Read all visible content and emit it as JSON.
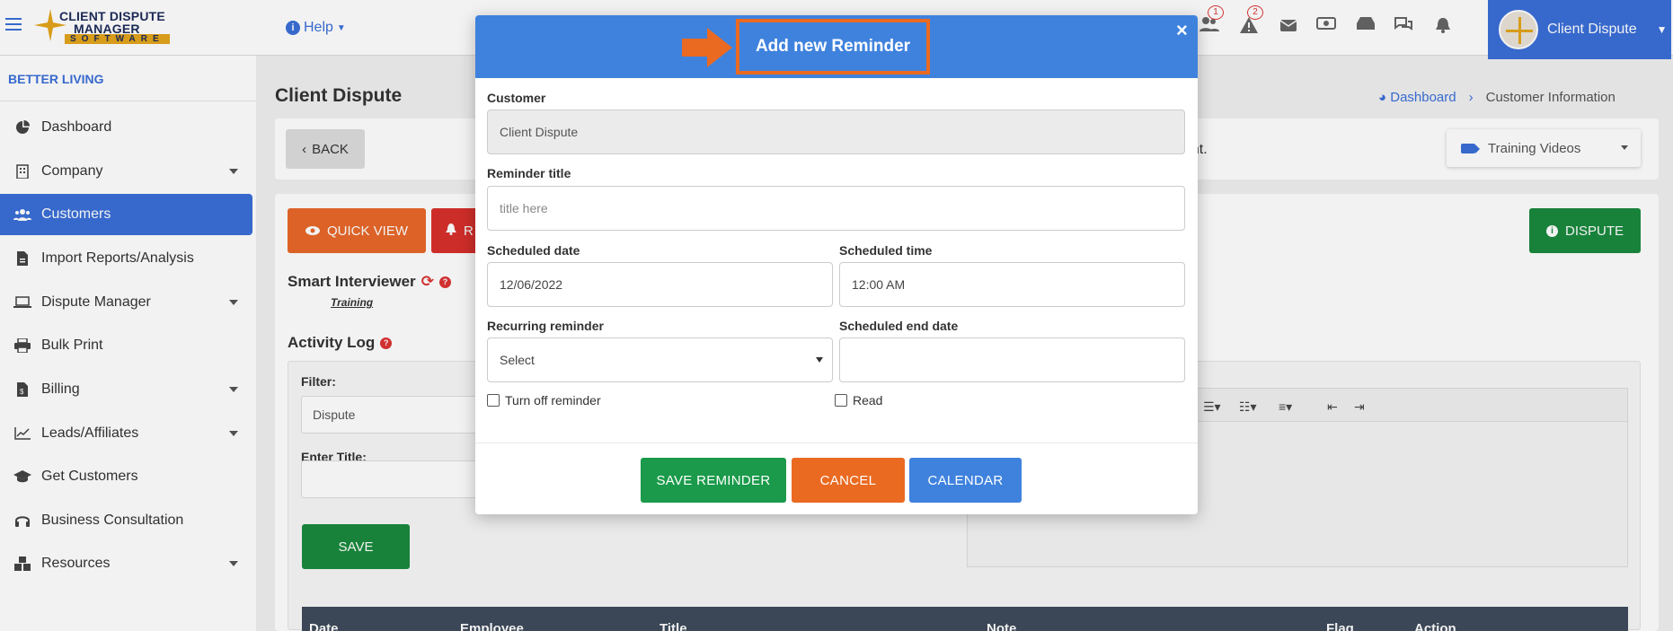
{
  "topbar": {
    "help_label": "Help",
    "logo": {
      "line1": "CLIENT DISPUTE",
      "line2": "MANAGER",
      "line3": "SOFTWARE"
    },
    "icon_badges": [
      "1",
      "2"
    ],
    "user_name": "Client Dispute"
  },
  "sidebar": {
    "org_name": "BETTER LIVING",
    "items": [
      {
        "label": "Dashboard",
        "icon": "dashboard-icon"
      },
      {
        "label": "Company",
        "icon": "building-icon"
      },
      {
        "label": "Customers",
        "icon": "users-icon"
      },
      {
        "label": "Import Reports/Analysis",
        "icon": "file-import-icon"
      },
      {
        "label": "Dispute Manager",
        "icon": "laptop-icon"
      },
      {
        "label": "Bulk Print",
        "icon": "printer-icon"
      },
      {
        "label": "Billing",
        "icon": "invoice-icon"
      },
      {
        "label": "Leads/Affiliates",
        "icon": "chart-icon"
      },
      {
        "label": "Get Customers",
        "icon": "graduation-cap-icon"
      },
      {
        "label": "Business Consultation",
        "icon": "headset-icon"
      },
      {
        "label": "Resources",
        "icon": "boxes-icon"
      }
    ]
  },
  "main": {
    "title": "Client Dispute",
    "breadcrumb": {
      "home": "Dashboard",
      "current": "Customer Information"
    },
    "back_label": "BACK",
    "notice_fragment": "unt.",
    "training_videos_label": "Training Videos",
    "quick_view_label": "QUICK VIEW",
    "r_button_label": "R",
    "dispute_label": "DISPUTE",
    "smart_interviewer_label": "Smart Interviewer",
    "training_link": "Training",
    "activity_log_label": "Activity Log",
    "filter_label": "Filter:",
    "filter_value": "Dispute",
    "enter_title_label": "Enter Title:",
    "save_label": "SAVE",
    "table_headers": [
      "Date",
      "Employee",
      "Title",
      "Note",
      "Flag",
      "Action"
    ]
  },
  "modal": {
    "title": "Add new Reminder",
    "close_glyph": "×",
    "customer_label": "Customer",
    "customer_value": "Client Dispute",
    "reminder_title_label": "Reminder title",
    "reminder_title_placeholder": "title here",
    "scheduled_date_label": "Scheduled date",
    "scheduled_date_value": "12/06/2022",
    "scheduled_time_label": "Scheduled time",
    "scheduled_time_value": "12:00 AM",
    "recurring_label": "Recurring reminder",
    "recurring_value": "Select",
    "end_date_label": "Scheduled end date",
    "end_date_value": "",
    "turn_off_label": "Turn off reminder",
    "read_label": "Read",
    "save_reminder_label": "SAVE REMINDER",
    "cancel_label": "CANCEL",
    "calendar_label": "CALENDAR"
  },
  "colors": {
    "primary": "#3a6fd8",
    "modal_header": "#3f82dd",
    "highlight": "#ea6a21",
    "success": "#1a8a3e",
    "orange": "#e8682a",
    "danger": "#d8302c",
    "badge": "#dd3333"
  }
}
